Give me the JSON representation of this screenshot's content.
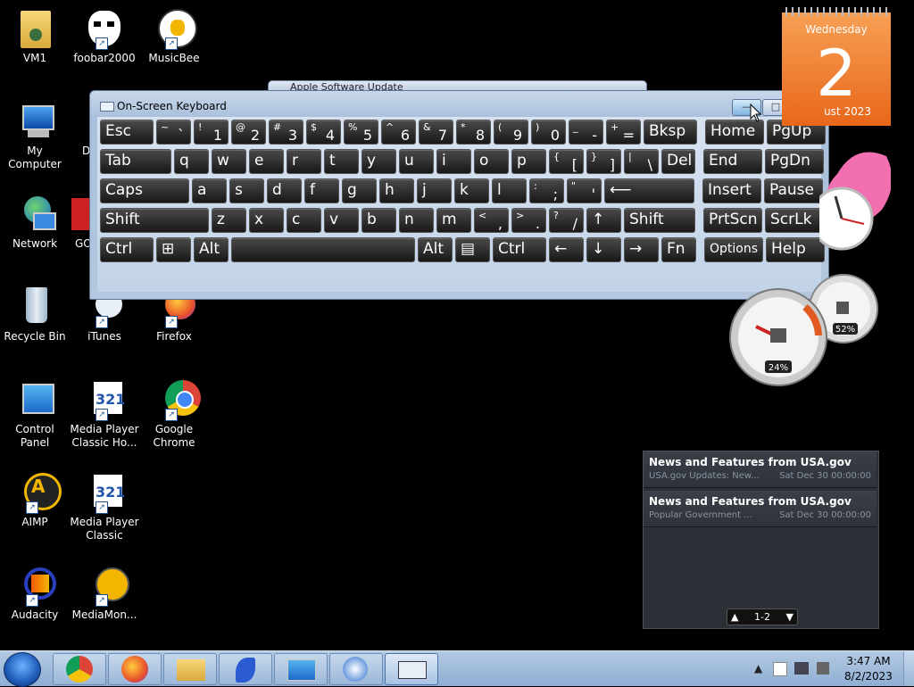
{
  "desktop": {
    "icons": [
      {
        "label": "VM1"
      },
      {
        "label": "foobar2000"
      },
      {
        "label": "MusicBee"
      },
      {
        "label": "My Computer"
      },
      {
        "label": "D"
      },
      {
        "label": "Network"
      },
      {
        "label": "GO"
      },
      {
        "label": "Recycle Bin"
      },
      {
        "label": "iTunes"
      },
      {
        "label": "Firefox"
      },
      {
        "label": "Control Panel"
      },
      {
        "label": "Media Player Classic Ho..."
      },
      {
        "label": "Google Chrome"
      },
      {
        "label": "AIMP"
      },
      {
        "label": "Media Player Classic"
      },
      {
        "label": "Audacity"
      },
      {
        "label": "MediaMon..."
      }
    ]
  },
  "background_window": {
    "title": "Apple Software Update"
  },
  "osk": {
    "title": "On-Screen Keyboard",
    "controls": {
      "minimize": "—",
      "maximize": "□",
      "close": "✕"
    },
    "keys": [
      {
        "main": "Esc"
      },
      {
        "shift": "~",
        "main": "`"
      },
      {
        "shift": "!",
        "main": "1"
      },
      {
        "shift": "@",
        "main": "2"
      },
      {
        "shift": "#",
        "main": "3"
      },
      {
        "shift": "$",
        "main": "4"
      },
      {
        "shift": "%",
        "main": "5"
      },
      {
        "shift": "^",
        "main": "6"
      },
      {
        "shift": "&",
        "main": "7"
      },
      {
        "shift": "*",
        "main": "8"
      },
      {
        "shift": "(",
        "main": "9"
      },
      {
        "shift": ")",
        "main": "0"
      },
      {
        "shift": "_",
        "main": "-"
      },
      {
        "shift": "+",
        "main": "="
      },
      {
        "main": "Bksp"
      },
      {
        "main": "Home"
      },
      {
        "main": "PgUp"
      },
      {
        "main": "Tab"
      },
      {
        "main": "q"
      },
      {
        "main": "w"
      },
      {
        "main": "e"
      },
      {
        "main": "r"
      },
      {
        "main": "t"
      },
      {
        "main": "y"
      },
      {
        "main": "u"
      },
      {
        "main": "i"
      },
      {
        "main": "o"
      },
      {
        "main": "p"
      },
      {
        "shift": "{",
        "main": "["
      },
      {
        "shift": "}",
        "main": "]"
      },
      {
        "shift": "|",
        "main": "\\"
      },
      {
        "main": "Del"
      },
      {
        "main": "End"
      },
      {
        "main": "PgDn"
      },
      {
        "main": "Caps"
      },
      {
        "main": "a"
      },
      {
        "main": "s"
      },
      {
        "main": "d"
      },
      {
        "main": "f"
      },
      {
        "main": "g"
      },
      {
        "main": "h"
      },
      {
        "main": "j"
      },
      {
        "main": "k"
      },
      {
        "main": "l"
      },
      {
        "shift": ":",
        "main": ";"
      },
      {
        "shift": "\"",
        "main": "'"
      },
      {
        "main": "⟵"
      },
      {
        "main": "Insert"
      },
      {
        "main": "Pause"
      },
      {
        "main": "Shift"
      },
      {
        "main": "z"
      },
      {
        "main": "x"
      },
      {
        "main": "c"
      },
      {
        "main": "v"
      },
      {
        "main": "b"
      },
      {
        "main": "n"
      },
      {
        "main": "m"
      },
      {
        "shift": "<",
        "main": ","
      },
      {
        "shift": ">",
        "main": "."
      },
      {
        "shift": "?",
        "main": "/"
      },
      {
        "main": "↑"
      },
      {
        "main": "Shift"
      },
      {
        "main": "PrtScn"
      },
      {
        "main": "ScrLk"
      },
      {
        "main": "Ctrl"
      },
      {
        "main": "⊞"
      },
      {
        "main": "Alt"
      },
      {
        "main": ""
      },
      {
        "main": "Alt"
      },
      {
        "main": "▤"
      },
      {
        "main": "Ctrl"
      },
      {
        "main": "←"
      },
      {
        "main": "↓"
      },
      {
        "main": "→"
      },
      {
        "main": "Fn"
      },
      {
        "main": "Options"
      },
      {
        "main": "Help"
      }
    ]
  },
  "calendar": {
    "day_name": "Wednesday",
    "day_number": "2",
    "month_year": "ust 2023"
  },
  "meter": {
    "cpu": "24%",
    "memory": "52%",
    "cpu_fraction": 0.24,
    "memory_fraction": 0.52
  },
  "rss": {
    "items": [
      {
        "title": "News and Features from USA.gov",
        "desc": "USA.gov Updates: New...",
        "date": "Sat Dec 30 00:00:00"
      },
      {
        "title": "News and Features from USA.gov",
        "desc": "Popular Government ...",
        "date": "Sat Dec 30 00:00:00"
      }
    ],
    "pager": "1-2"
  },
  "taskbar": {
    "time": "3:47 AM",
    "date": "8/2/2023",
    "tray_up": "▲"
  },
  "colors": {
    "accent": "#e8671a",
    "taskbar": "#9cb7d8",
    "key": "#262626"
  }
}
